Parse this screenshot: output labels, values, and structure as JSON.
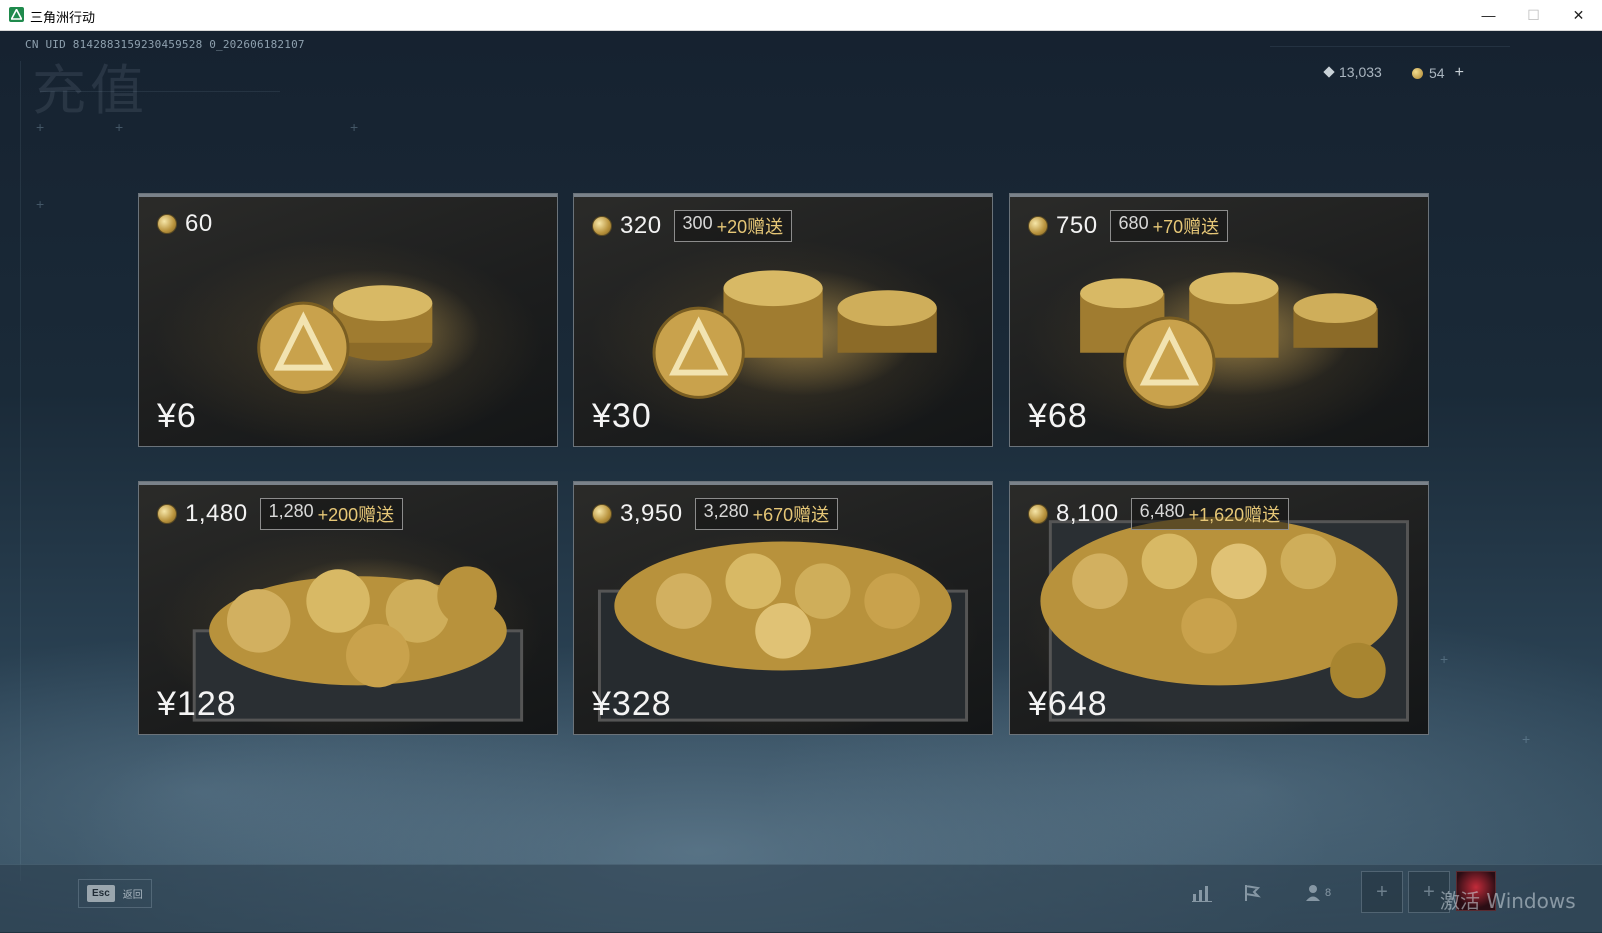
{
  "window": {
    "title": "三角洲行动",
    "minimize": "—",
    "maximize": "☐",
    "close": "✕"
  },
  "header": {
    "uid": "CN UID 8142883159230459528 0_202606182107",
    "page_title": "充值"
  },
  "currencies": {
    "premium_amount": "13,033",
    "coin_amount": "54",
    "add_label": "+"
  },
  "packs": [
    {
      "total": "60",
      "base": "",
      "bonus": "",
      "price": "¥6"
    },
    {
      "total": "320",
      "base": "300",
      "bonus": "+20赠送",
      "price": "¥30"
    },
    {
      "total": "750",
      "base": "680",
      "bonus": "+70赠送",
      "price": "¥68"
    },
    {
      "total": "1,480",
      "base": "1,280",
      "bonus": "+200赠送",
      "price": "¥128"
    },
    {
      "total": "3,950",
      "base": "3,280",
      "bonus": "+670赠送",
      "price": "¥328"
    },
    {
      "total": "8,100",
      "base": "6,480",
      "bonus": "+1,620赠送",
      "price": "¥648"
    }
  ],
  "bottombar": {
    "esc_key": "Esc",
    "esc_label": "返回",
    "friends_count": "8",
    "activation_watermark": "激活 Windows"
  },
  "colors": {
    "bonus_accent": "#e6c777",
    "coin_gold": "#b8923c"
  }
}
